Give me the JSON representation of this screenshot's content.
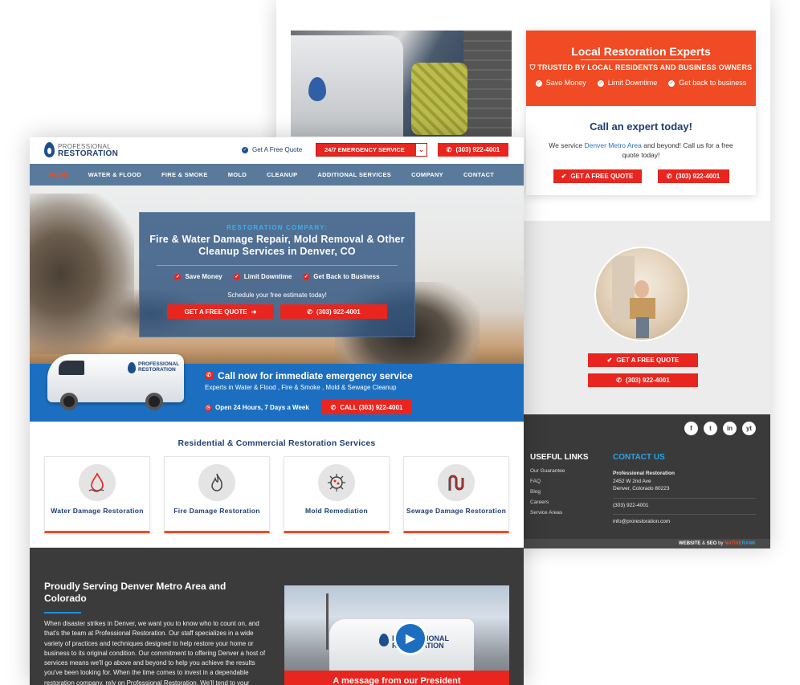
{
  "back": {
    "expert": {
      "title": "Local Restoration Experts",
      "subtitle": "TRUSTED BY LOCAL RESIDENTS AND BUSINESS OWNERS",
      "features": [
        "Save Money",
        "Limit Downtime",
        "Get back to business"
      ],
      "call_title": "Call an expert today!",
      "desc_before": "We service ",
      "desc_link": "Denver Metro Area",
      "desc_after": " and beyond! Call us for a free quote today!",
      "quote_btn": "GET A FREE QUOTE",
      "phone_btn": "(303) 922-4001"
    },
    "gray": {
      "quote_btn": "GET A FREE QUOTE",
      "phone_btn": "(303) 922-4001"
    },
    "footer": {
      "social": [
        "f",
        "t",
        "in",
        "yt"
      ],
      "useful_title": "USEFUL LINKS",
      "useful_links": [
        "Our Guarantee",
        "FAQ",
        "Blog",
        "Careers",
        "Service Areas"
      ],
      "contact_title": "CONTACT US",
      "company": "Professional Restoration",
      "street": "2452 W 2nd Ave",
      "city": "Denver, Colorado 80223",
      "phone": "(303) 922-4001",
      "email": "info@prorestoration.com",
      "credit_prefix": "WEBSITE",
      "credit_amp": "&",
      "credit_mid": "SEO",
      "credit_by": "by",
      "credit_brand_a": "NATIVE",
      "credit_brand_b": "RANK"
    }
  },
  "front": {
    "logo": {
      "line1": "PROFESSIONAL",
      "line2": "RESTORATION"
    },
    "header": {
      "quote_link": "Get A Free Quote",
      "emergency": "24/7 EMERGENCY SERVICE",
      "phone": "(303) 922-4001"
    },
    "nav": [
      "HOME",
      "WATER & FLOOD",
      "FIRE & SMOKE",
      "MOLD",
      "CLEANUP",
      "ADDITIONAL SERVICES",
      "COMPANY",
      "CONTACT"
    ],
    "hero": {
      "kicker": "RESTORATION COMPANY:",
      "title": "Fire & Water Damage Repair, Mold Removal & Other Cleanup Services in Denver, CO",
      "features": [
        "Save Money",
        "Limit Downtime",
        "Get Back to Business"
      ],
      "schedule": "Schedule your free estimate today!",
      "quote_btn": "GET A FREE QUOTE",
      "phone_btn": "(303) 922-4001"
    },
    "van": {
      "line1": "PROFESSIONAL",
      "line2": "RESTORATION"
    },
    "callband": {
      "title": "Call now for immediate emergency service",
      "subtitle": "Experts in Water & Flood , Fire & Smoke , Mold & Sewage Cleanup",
      "hours": "Open 24 Hours, 7 Days a Week",
      "call_btn": "CALL (303) 922-4001"
    },
    "services": {
      "heading": "Residential & Commercial Restoration Services",
      "items": [
        {
          "name": "Water Damage Restoration",
          "icon": "water-drop-icon"
        },
        {
          "name": "Fire Damage Restoration",
          "icon": "flame-icon"
        },
        {
          "name": "Mold Remediation",
          "icon": "mold-spore-icon"
        },
        {
          "name": "Sewage Damage Restoration",
          "icon": "pipe-icon"
        }
      ]
    },
    "serving": {
      "title": "Proudly Serving Denver Metro Area and Colorado",
      "text": "When disaster strikes in Denver, we want you to know who to count on, and that's the team at Professional Restoration. Our staff specializes in a wide variety of practices and techniques designed to help restore your home or business to its original condition. Our commitment to offering Denver a host of services means we'll go above and beyond to help you achieve the results you've been looking for. When the time comes to invest in a dependable restoration company, rely on Professional Restoration. We'll tend to your",
      "video_caption": "A message from our President"
    }
  },
  "colors": {
    "accent_red": "#e8261f",
    "orange": "#f04b24",
    "navy": "#1d3e72",
    "blue": "#1c6fc0",
    "nav": "#5a7a9c"
  }
}
